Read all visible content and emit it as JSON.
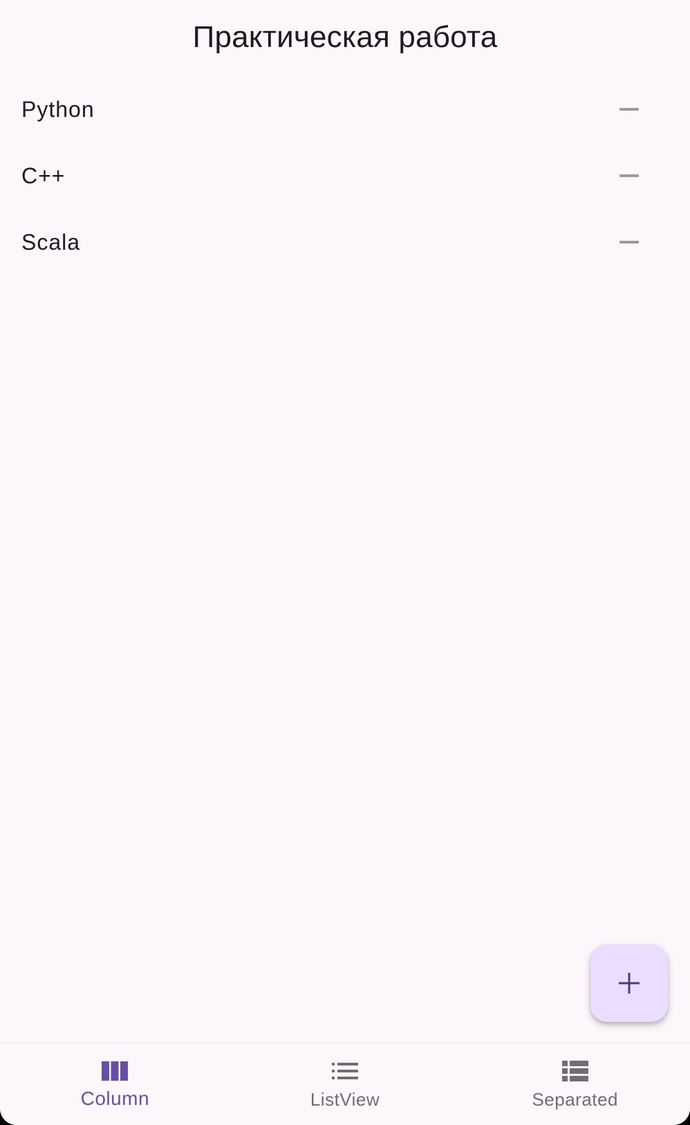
{
  "app_bar": {
    "title": "Практическая работа"
  },
  "list": {
    "items": [
      {
        "label": "Python",
        "action_icon": "remove-icon"
      },
      {
        "label": "C++",
        "action_icon": "remove-icon"
      },
      {
        "label": "Scala",
        "action_icon": "remove-icon"
      }
    ]
  },
  "fab": {
    "icon": "add-icon"
  },
  "bottom_nav": {
    "items": [
      {
        "label": "Column",
        "icon": "view-column-icon",
        "active": true
      },
      {
        "label": "ListView",
        "icon": "list-icon",
        "active": false
      },
      {
        "label": "Separated",
        "icon": "view-list-icon",
        "active": false
      }
    ]
  },
  "colors": {
    "background": "#fcf7fb",
    "text_primary": "#1d1b20",
    "icon_muted": "#9d9a9f",
    "fab_container": "#eaddff",
    "fab_icon": "#4b3b76",
    "nav_active": "#6750a4",
    "nav_inactive": "#6f6c72"
  }
}
